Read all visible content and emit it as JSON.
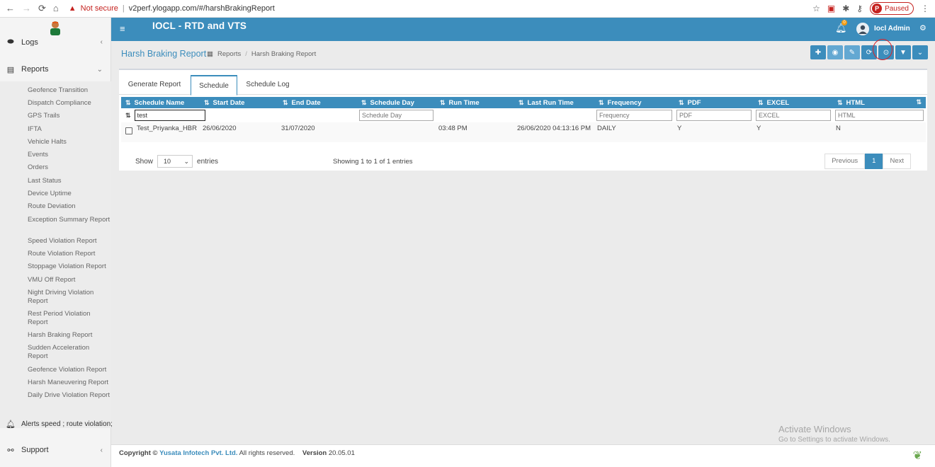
{
  "browser": {
    "security": "Not secure",
    "url": "v2perf.ylogapp.com/#/harshBrakingReport",
    "paused_label": "Paused",
    "profile_initial": "P"
  },
  "app": {
    "title": "IOCL - RTD and VTS",
    "user": "Iocl Admin",
    "notif_count": "0"
  },
  "sidebar": {
    "logs_label": "Logs",
    "reports_label": "Reports",
    "items": [
      "Geofence Transition",
      "Dispatch Compliance",
      "GPS Trails",
      "IFTA",
      "Vehicle Halts",
      "Events",
      "Orders",
      "Last Status",
      "Device Uptime",
      "Route Deviation",
      "Exception Summary Report",
      "Speed Violation Report",
      "Route Violation Report",
      "Stoppage Violation Report",
      "VMU Off Report",
      "Night Driving Violation Report",
      "Rest Period Violation Report",
      "Harsh Braking Report",
      "Sudden Acceleration Report",
      "Geofence Violation Report",
      "Harsh Maneuvering Report",
      "Daily Drive Violation Report"
    ],
    "alerts_label": "Alerts speed ; route violation;",
    "support_label": "Support"
  },
  "page": {
    "title": "Harsh Braking Report",
    "breadcrumb_root": "Reports",
    "breadcrumb_sep": "/",
    "breadcrumb_current": "Harsh Braking Report"
  },
  "tabs": [
    "Generate Report",
    "Schedule",
    "Schedule Log"
  ],
  "table": {
    "columns": [
      "Schedule Name",
      "Start Date",
      "End Date",
      "Schedule Day",
      "Run Time",
      "Last Run Time",
      "Frequency",
      "PDF",
      "EXCEL",
      "HTML"
    ],
    "filters": {
      "schedule_name": "test",
      "schedule_day_placeholder": "Schedule Day",
      "frequency_placeholder": "Frequency",
      "pdf_placeholder": "PDF",
      "excel_placeholder": "EXCEL",
      "html_placeholder": "HTML"
    },
    "rows": [
      {
        "name": "Test_Priyanka_HBR",
        "start": "26/06/2020",
        "end": "31/07/2020",
        "day": "",
        "run": "03:48 PM",
        "last_run": "26/06/2020 04:13:16 PM",
        "frequency": "DAILY",
        "pdf": "Y",
        "excel": "Y",
        "html": "N"
      }
    ]
  },
  "list_footer": {
    "show": "Show",
    "page_size": "10",
    "entries": "entries",
    "info": "Showing 1 to 1 of 1 entries",
    "previous": "Previous",
    "current_page": "1",
    "next": "Next"
  },
  "footer": {
    "copyright": "Copyright ©",
    "company": "Yusata Infotech Pvt. Ltd.",
    "rights": "All rights reserved.",
    "version_label": "Version",
    "version": "20.05.01"
  },
  "watermark": {
    "line1": "Activate Windows",
    "line2": "Go to Settings to activate Windows."
  },
  "colors": {
    "primary": "#3c8dbc",
    "annotation": "#d9232a"
  }
}
